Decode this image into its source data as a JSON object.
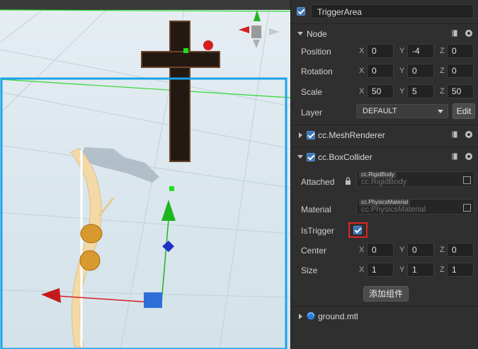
{
  "node_name": "TriggerArea",
  "sections": {
    "node": "Node",
    "mesh_renderer": "cc.MeshRenderer",
    "box_collider": "cc.BoxCollider",
    "ground": "ground.mtl"
  },
  "node": {
    "position": {
      "label": "Position",
      "x": "0",
      "y": "-4",
      "z": "0"
    },
    "rotation": {
      "label": "Rotation",
      "x": "0",
      "y": "0",
      "z": "0"
    },
    "scale": {
      "label": "Scale",
      "x": "50",
      "y": "5",
      "z": "50"
    },
    "layer": {
      "label": "Layer",
      "value": "DEFAULT",
      "edit": "Edit"
    }
  },
  "collider": {
    "attached": {
      "label": "Attached",
      "tag": "cc.RigidBody",
      "placeholder": "cc.RigidBody"
    },
    "material": {
      "label": "Material",
      "tag": "cc.PhysicsMaterial",
      "placeholder": "cc.PhysicsMaterial"
    },
    "is_trigger": {
      "label": "IsTrigger",
      "checked": true
    },
    "center": {
      "label": "Center",
      "x": "0",
      "y": "0",
      "z": "0"
    },
    "size": {
      "label": "Size",
      "x": "1",
      "y": "1",
      "z": "1"
    }
  },
  "add_component": "添加组件",
  "axis_letters": {
    "x": "X",
    "y": "Y",
    "z": "Z"
  },
  "colors": {
    "selection": "#1aa3e8",
    "highlight": "#e02525",
    "accent": "#3a74b5"
  }
}
